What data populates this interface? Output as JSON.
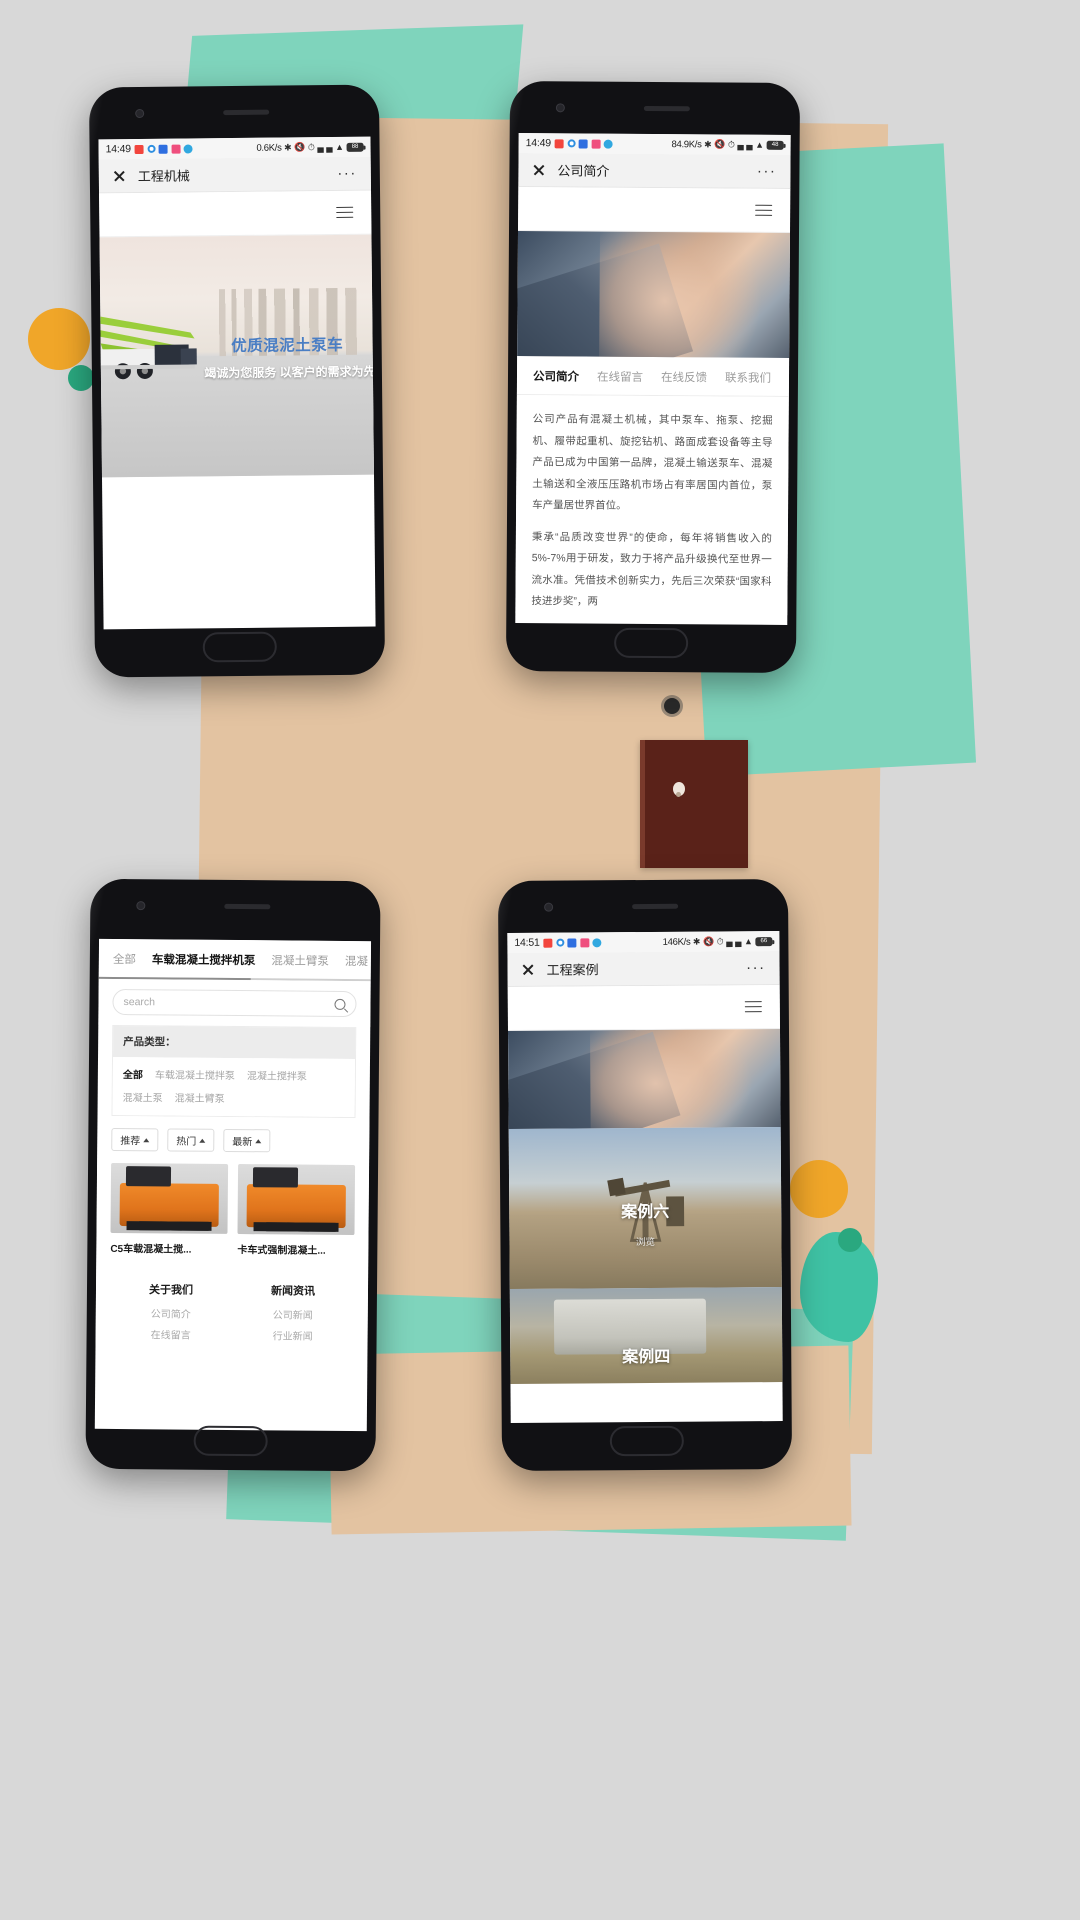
{
  "background": {
    "palette": {
      "page": "#d8d8d8",
      "tan": "#e3c3a1",
      "teal": "#7fd4bc",
      "orange": "#f0a629",
      "green": "#2aa87f",
      "brown": "#5a2219"
    }
  },
  "phones": [
    {
      "id": "phone-1",
      "status": {
        "clock": "14:49",
        "speed": "0.6K/s",
        "battery": "88",
        "left_icons": [
          "message-icon",
          "sync-icon",
          "app-blue-icon",
          "app-pink-icon",
          "browser-icon"
        ],
        "right_icons": [
          "bluetooth-icon",
          "mute-icon",
          "alarm-icon",
          "signal-icon",
          "signal2-icon",
          "wifi-icon",
          "battery-icon"
        ]
      },
      "titlebar": {
        "close": "✕",
        "title": "工程机械",
        "more": "···"
      },
      "banner": {
        "title": "优质混泥土泵车",
        "subtitle": "竭诚为您服务 以客户的需求为先",
        "title_color": "#4a7ec4"
      }
    },
    {
      "id": "phone-2",
      "status": {
        "clock": "14:49",
        "speed": "84.9K/s",
        "battery": "48",
        "left_icons": [
          "message-icon",
          "sync-icon",
          "app-blue-icon",
          "app-pink-icon",
          "browser-icon"
        ],
        "right_icons": [
          "bluetooth-icon",
          "mute-icon",
          "alarm-icon",
          "signal-icon",
          "signal2-icon",
          "wifi-icon",
          "battery-icon"
        ]
      },
      "titlebar": {
        "close": "✕",
        "title": "公司简介",
        "more": "···"
      },
      "tabs": [
        {
          "label": "公司简介",
          "active": true
        },
        {
          "label": "在线留言",
          "active": false
        },
        {
          "label": "在线反馈",
          "active": false
        },
        {
          "label": "联系我们",
          "active": false
        }
      ],
      "paragraphs": [
        "公司产品有混凝土机械，其中泵车、拖泵、挖掘机、履带起重机、旋挖钻机、路面成套设备等主导产品已成为中国第一品牌，混凝土输送泵车、混凝土输送和全液压压路机市场占有率居国内首位，泵车产量居世界首位。",
        "秉承“品质改变世界”的使命，每年将销售收入的5%-7%用于研发，致力于将产品升级换代至世界一流水准。凭借技术创新实力，先后三次荣获“国家科技进步奖”，两"
      ]
    },
    {
      "id": "phone-3",
      "cat_tabs": [
        {
          "label": "全部",
          "active": false
        },
        {
          "label": "车载混凝土搅拌机泵",
          "active": true
        },
        {
          "label": "混凝土臂泵",
          "active": false
        },
        {
          "label": "混凝",
          "active": false
        }
      ],
      "search": {
        "placeholder": "search",
        "icon": "search-icon"
      },
      "filter": {
        "heading": "产品类型：",
        "row1": [
          {
            "label": "全部",
            "active": true
          },
          {
            "label": "车载混凝土搅拌泵",
            "active": false
          },
          {
            "label": "混凝土搅拌泵",
            "active": false
          }
        ],
        "row2": [
          {
            "label": "混凝土泵",
            "active": false
          },
          {
            "label": "混凝土臂泵",
            "active": false
          }
        ]
      },
      "sort_chips": [
        {
          "label": "推荐"
        },
        {
          "label": "热门"
        },
        {
          "label": "最新"
        }
      ],
      "products": [
        {
          "name": "C5车载混凝土搅..."
        },
        {
          "name": "卡车式强制混凝土..."
        }
      ],
      "footer_cols": [
        {
          "heading": "关于我们",
          "links": [
            "公司简介",
            "在线留言"
          ]
        },
        {
          "heading": "新闻资讯",
          "links": [
            "公司新闻",
            "行业新闻"
          ]
        }
      ]
    },
    {
      "id": "phone-4",
      "status": {
        "clock": "14:51",
        "speed": "146K/s",
        "battery": "66",
        "left_icons": [
          "message-icon",
          "sync-icon",
          "app-blue-icon",
          "app-pink-icon",
          "browser-icon"
        ],
        "right_icons": [
          "bluetooth-icon",
          "mute-icon",
          "alarm-icon",
          "signal-icon",
          "signal2-icon",
          "wifi-icon",
          "battery-icon"
        ]
      },
      "titlebar": {
        "close": "✕",
        "title": "工程案例",
        "more": "···"
      },
      "cases": [
        {
          "label": "案例六",
          "action": "浏览"
        },
        {
          "label": "案例四",
          "action": ""
        }
      ]
    }
  ]
}
